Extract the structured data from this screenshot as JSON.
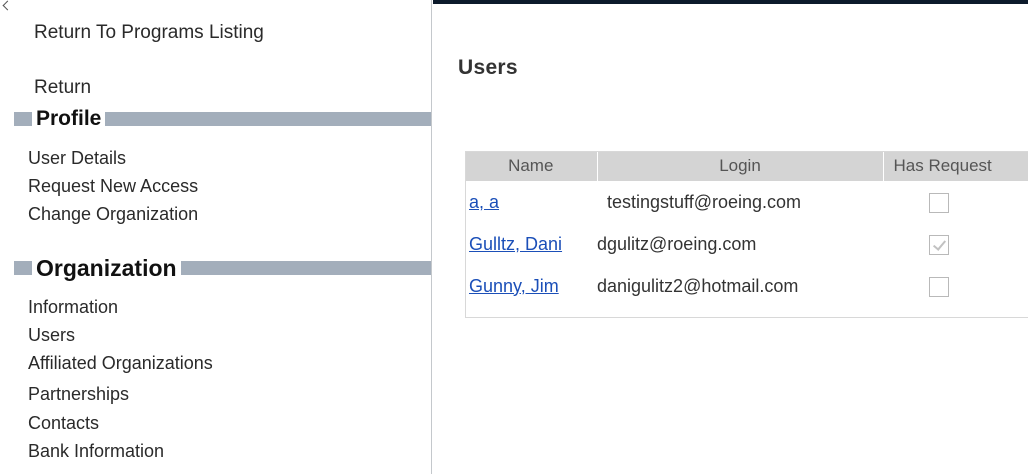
{
  "sidebar": {
    "return_to_programs": "Return To Programs Listing",
    "return": "Return",
    "sections": [
      {
        "title": "Profile",
        "items": [
          "User Details",
          "Request New Access",
          "Change Organization"
        ]
      },
      {
        "title": "Organization",
        "items": [
          "Information",
          "Users",
          "Affiliated Organizations",
          "Partnerships",
          "Contacts",
          "Bank Information"
        ]
      }
    ]
  },
  "main": {
    "title": "Users",
    "table": {
      "columns": [
        "Name",
        "Login",
        "Has Request"
      ],
      "rows": [
        {
          "name": "a, a",
          "login": "testingstuff@roeing.com",
          "has_request": false
        },
        {
          "name": "Gulltz, Dani",
          "login": "dgulitz@roeing.com",
          "has_request": true
        },
        {
          "name": "Gunny, Jim",
          "login": "danigulitz2@hotmail.com",
          "has_request": false
        }
      ]
    }
  }
}
